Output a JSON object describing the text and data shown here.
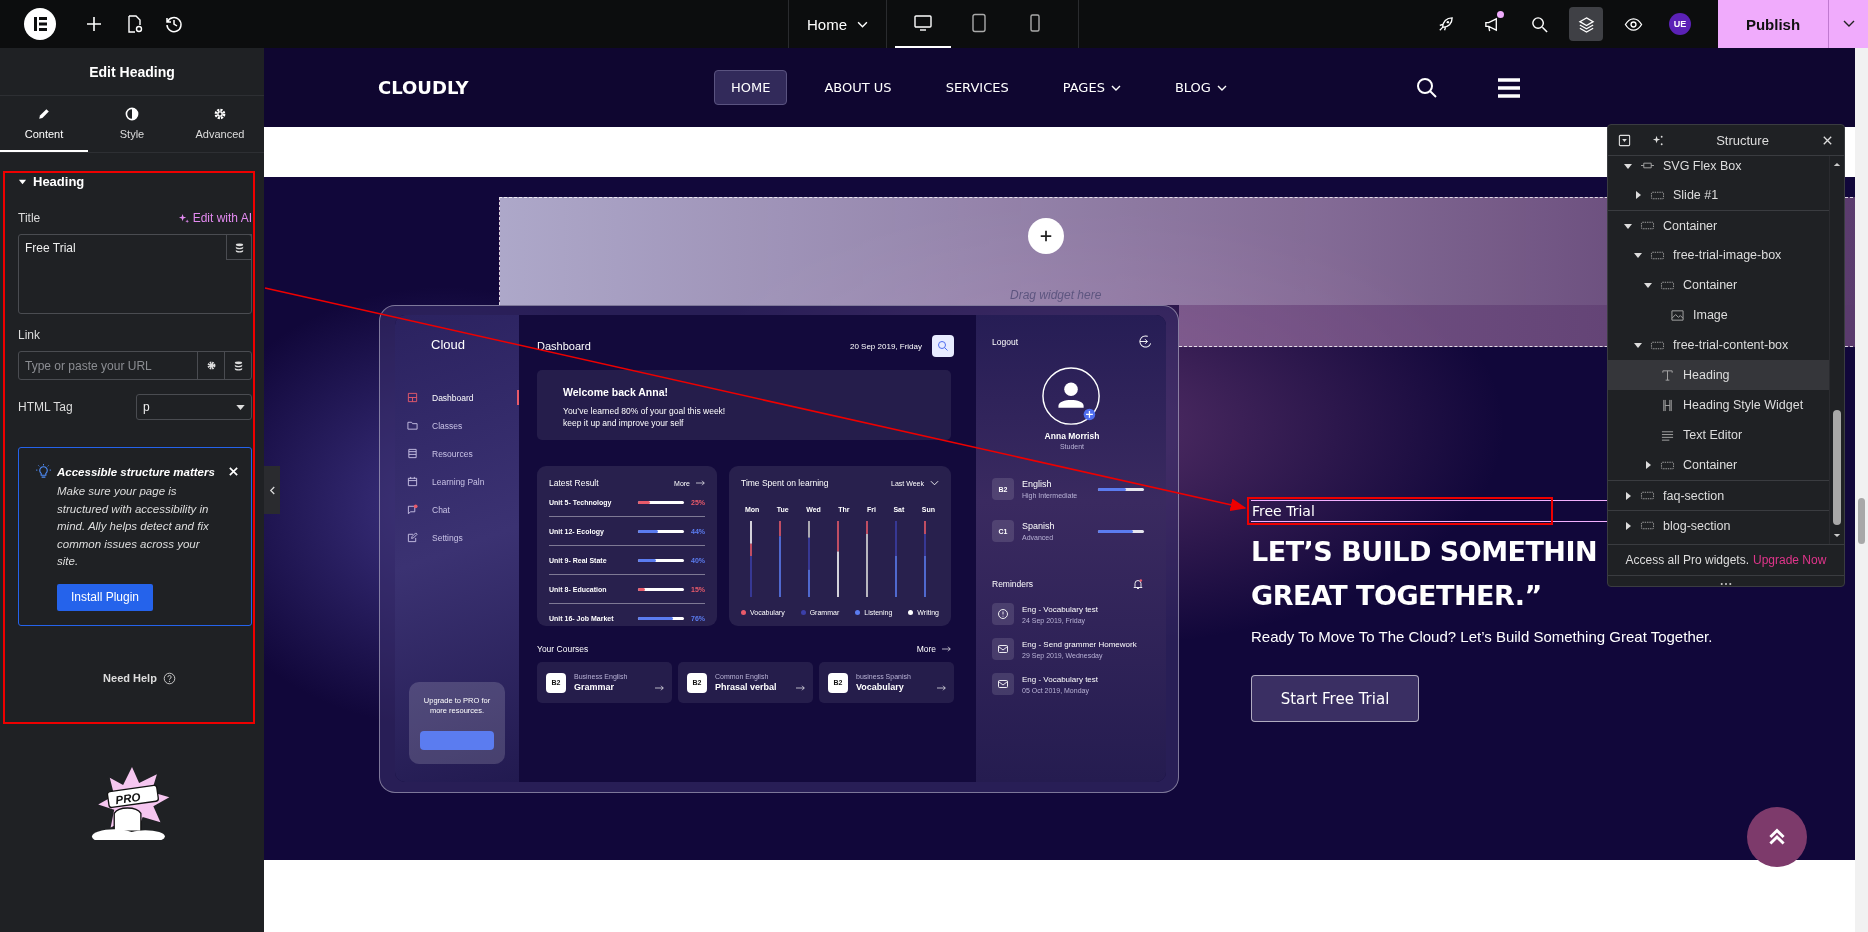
{
  "topbar": {
    "page": "Home",
    "devices": [
      {
        "kind": "desktop",
        "selected": true
      },
      {
        "kind": "tablet",
        "selected": false
      },
      {
        "kind": "mobile",
        "selected": false
      }
    ],
    "tools": [
      {
        "kind": "rocket",
        "selected": false,
        "badge": false
      },
      {
        "kind": "megaphone",
        "selected": false,
        "badge": true
      },
      {
        "kind": "search",
        "selected": false,
        "badge": false
      },
      {
        "kind": "layers",
        "selected": true,
        "badge": false
      },
      {
        "kind": "eye",
        "selected": false,
        "badge": false
      }
    ],
    "avatar": "UE",
    "publish": "Publish"
  },
  "panel": {
    "title": "Edit Heading",
    "tabs": [
      {
        "kind": "content",
        "label": "Content",
        "selected": true
      },
      {
        "kind": "style",
        "label": "Style",
        "selected": false
      },
      {
        "kind": "advanced",
        "label": "Advanced",
        "selected": false
      }
    ],
    "section": {
      "title": "Heading",
      "expanded": true
    },
    "title_field": {
      "label": "Title",
      "ai_link": "Edit with AI",
      "value": "Free Trial"
    },
    "link_field": {
      "label": "Link",
      "placeholder": "Type or paste your URL"
    },
    "tag_field": {
      "label": "HTML Tag",
      "value": "p"
    },
    "notice": {
      "title": "Accessible structure matters",
      "body": "Make sure your page is structured with accessibility in mind. Ally helps detect and fix common issues across your site.",
      "button": "Install Plugin"
    },
    "help": "Need Help",
    "promo": "PRO"
  },
  "site": {
    "logo": "CLOUDLY",
    "nav": [
      {
        "label": "HOME",
        "selected": true,
        "dropdown": false
      },
      {
        "label": "ABOUT US",
        "selected": false,
        "dropdown": false
      },
      {
        "label": "SERVICES",
        "selected": false,
        "dropdown": false
      },
      {
        "label": "PAGES",
        "selected": false,
        "dropdown": true
      },
      {
        "label": "BLOG",
        "selected": false,
        "dropdown": true
      }
    ],
    "dropzone": "Drag widget here",
    "hero": {
      "tag": "Free Trial",
      "heading": [
        "LET’S BUILD SOMETHIN",
        "GREAT TOGETHER.”"
      ],
      "text": "Ready To Move To The Cloud? Let’s Build Something Great Together.",
      "button": "Start Free Trial"
    }
  },
  "dashboard": {
    "brand": "Cloud",
    "nav": [
      {
        "kind": "dashboard",
        "label": "Dashboard",
        "selected": true,
        "badge": false
      },
      {
        "kind": "folder",
        "label": "Classes",
        "selected": false,
        "badge": false
      },
      {
        "kind": "archive",
        "label": "Resources",
        "selected": false,
        "badge": false
      },
      {
        "kind": "calendar",
        "label": "Learning Paln",
        "selected": false,
        "badge": false
      },
      {
        "kind": "chat",
        "label": "Chat",
        "selected": false,
        "badge": true
      },
      {
        "kind": "edit",
        "label": "Settings",
        "selected": false,
        "badge": false
      }
    ],
    "upgrade": "Upgrade to PRO for more resources.",
    "title": "Dashboard",
    "date": "20 Sep 2019, Friday",
    "welcome": {
      "title": "Welcome back Anna!",
      "lines": [
        "You’ve learned 80% of your goal this week!",
        "keep it up and improve your self"
      ]
    },
    "results": {
      "title": "Latest Result",
      "more": "More",
      "rows": [
        {
          "name": "Unit 5- Technology",
          "level": 0.25,
          "reading": "25%",
          "color": "#e85a6a"
        },
        {
          "name": "Unit 12- Ecology",
          "level": 0.44,
          "reading": "44%",
          "color": "#5b7cf0"
        },
        {
          "name": "Unit 9- Real State",
          "level": 0.4,
          "reading": "40%",
          "color": "#5b7cf0"
        },
        {
          "name": "Unit 8- Education",
          "level": 0.15,
          "reading": "15%",
          "color": "#e85a6a"
        },
        {
          "name": "Unit 16- Job Market",
          "level": 0.76,
          "reading": "76%",
          "color": "#5b7cf0"
        }
      ]
    },
    "time": {
      "title": "Time Spent on learning",
      "period": "Last Week",
      "days": [
        "Mon",
        "Tue",
        "Wed",
        "Thr",
        "Fri",
        "Sat",
        "Sun"
      ],
      "legend": [
        {
          "label": "Vocabulary",
          "color": "#e85a6a"
        },
        {
          "label": "Grammar",
          "color": "#3b3fa8"
        },
        {
          "label": "Listening",
          "color": "#5b7cf0"
        },
        {
          "label": "Writing",
          "color": "#ffffff"
        }
      ]
    },
    "courses": {
      "title": "Your Courses",
      "more": "More",
      "items": [
        {
          "grade": "B2",
          "category": "Business English",
          "name": "Grammar"
        },
        {
          "grade": "B2",
          "category": "Common English",
          "name": "Phrasal verbal"
        },
        {
          "grade": "B2",
          "category": "business Spanish",
          "name": "Vocabulary"
        }
      ]
    },
    "profile": {
      "logout": "Logout",
      "name": "Anna Morrish",
      "role": "Student"
    },
    "languages": [
      {
        "grade": "B2",
        "name": "English",
        "note": "High Intermediate",
        "level": 0.6
      },
      {
        "grade": "C1",
        "name": "Spanish",
        "note": "Advanced",
        "level": 0.75
      }
    ],
    "reminders": {
      "title": "Reminders",
      "items": [
        {
          "kind": "alert",
          "title": "Eng - Vocabulary test",
          "date": "24 Sep 2019, Friday"
        },
        {
          "kind": "mail",
          "title": "Eng - Send grammer Homework",
          "date": "29 Sep 2019, Wednesday"
        },
        {
          "kind": "mail",
          "title": "Eng - Vocabulary test",
          "date": "05 Oct 2019, Monday"
        }
      ]
    }
  },
  "structure": {
    "title": "Structure",
    "tree": [
      {
        "label": "SVG Flex Box",
        "kind": "flexbox",
        "selected": false,
        "expanded": true,
        "children": [
          {
            "label": "Slide #1",
            "kind": "container",
            "selected": false,
            "expanded": false
          }
        ]
      },
      {
        "label": "Container",
        "kind": "container",
        "selected": false,
        "expanded": true,
        "children": [
          {
            "label": "free-trial-image-box",
            "kind": "container",
            "selected": false,
            "expanded": true,
            "children": [
              {
                "label": "Container",
                "kind": "container",
                "selected": false,
                "expanded": true,
                "children": [
                  {
                    "label": "Image",
                    "kind": "image",
                    "selected": false
                  }
                ]
              }
            ]
          },
          {
            "label": "free-trial-content-box",
            "kind": "container",
            "selected": false,
            "expanded": true,
            "children": [
              {
                "label": "Heading",
                "kind": "heading",
                "selected": true
              },
              {
                "label": "Heading Style Widget",
                "kind": "heading-style",
                "selected": false
              },
              {
                "label": "Text Editor",
                "kind": "text-editor",
                "selected": false
              },
              {
                "label": "Container",
                "kind": "container",
                "selected": false,
                "expanded": false
              }
            ]
          }
        ]
      },
      {
        "label": "faq-section",
        "kind": "container",
        "selected": false,
        "expanded": false
      },
      {
        "label": "blog-section",
        "kind": "container",
        "selected": false,
        "expanded": false
      }
    ],
    "footer": "Access all Pro widgets.",
    "upgrade": "Upgrade Now"
  }
}
